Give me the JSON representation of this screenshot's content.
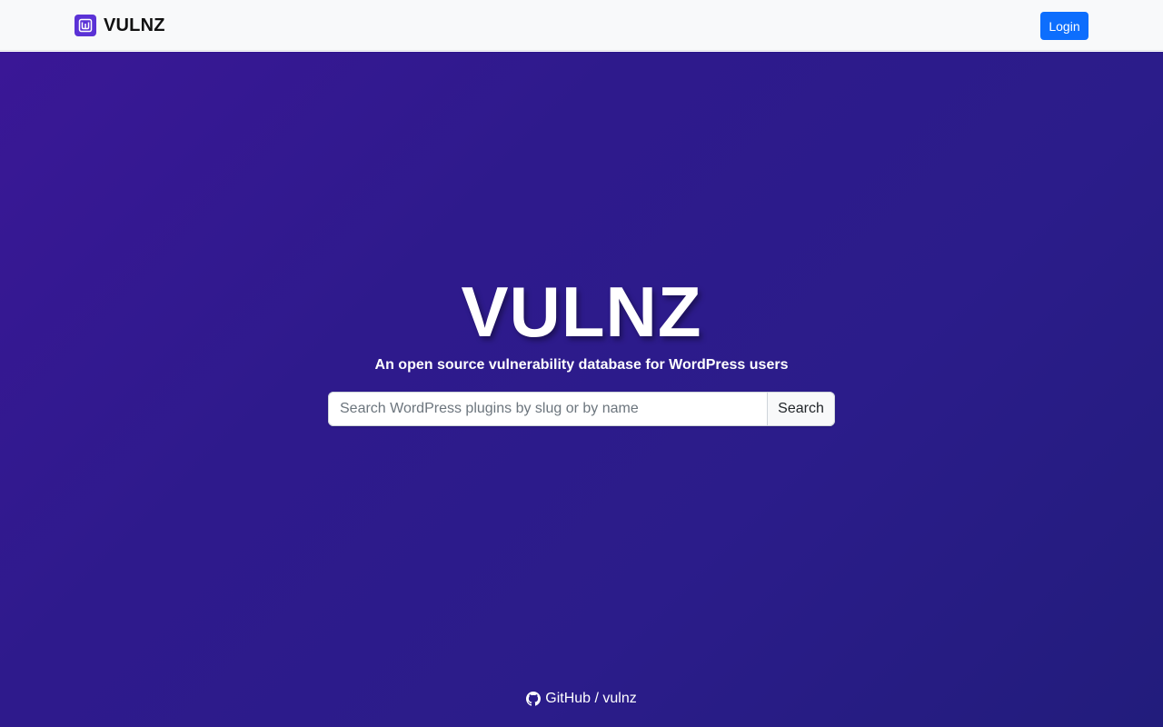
{
  "navbar": {
    "brand_name": "VULNZ",
    "logo_icon": "vulnz-logo-icon",
    "login_label": "Login",
    "background": "#f8f9fa",
    "login_color": "#0d6efd"
  },
  "hero": {
    "title": "VULNZ",
    "subtitle": "An open source vulnerability database for WordPress users",
    "background_start": "#3a1796",
    "background_end": "#221c7c"
  },
  "search": {
    "placeholder": "Search WordPress plugins by slug or by name",
    "value": "",
    "button_label": "Search"
  },
  "footer": {
    "github_icon": "github-icon",
    "link_text": "GitHub / vulnz"
  }
}
